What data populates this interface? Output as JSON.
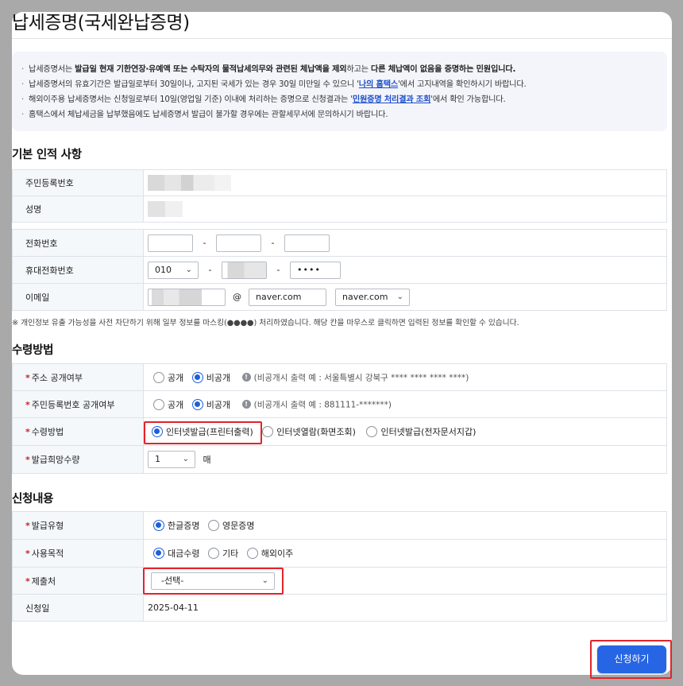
{
  "title": "납세증명(국세완납증명)",
  "notice": {
    "l1_a": "납세증명서는 ",
    "l1_b": "발급일 현재 기한연장·유예액 또는 수탁자의 물적납세의무와 관련된 체납액을 제외",
    "l1_c": "하고는 ",
    "l1_d": "다른 체납액이 없음을 증명하는 민원입니다.",
    "l2_a": "납세증명서의 유효기간은 발급일로부터 30일이나, 고지된 국세가 있는 경우 30일 미만일 수 있으니 '",
    "l2_link": "나의 홈택스",
    "l2_b": "'에서 고지내역을 확인하시기 바랍니다.",
    "l3_a": "해외이주용 납세증명서는 신청일로부터 10일(영업일 기준) 이내에 처리하는 증명으로 신청결과는 '",
    "l3_link": "민원증명 처리결과 조회",
    "l3_b": "'에서 확인 가능합니다.",
    "l4": "홈택스에서 체납세금을 납부했음에도 납세증명서 발급이 불가할 경우에는 관할세무서에 문의하시기 바랍니다."
  },
  "basic": {
    "heading": "기본 인적 사항",
    "rrn_label": "주민등록번호",
    "name_label": "성명",
    "phone_label": "전화번호",
    "mobile_label": "휴대전화번호",
    "mobile_prefix": "010",
    "mobile_last": "••••",
    "email_label": "이메일",
    "email_at": "@",
    "email_domain": "naver.com",
    "email_domain_select": "naver.com",
    "dash": "-"
  },
  "privacy_note": "※ 개인정보 유출 가능성을 사전 차단하기 위해 일부 정보를 마스킹(●●●●) 처리하였습니다. 해당 칸을 마우스로 클릭하면 입력된 정보를 확인할 수 있습니다.",
  "receive": {
    "heading": "수령방법",
    "addr_label": "주소 공개여부",
    "rrn_open_label": "주민등록번호 공개여부",
    "public": "공개",
    "private": "비공개",
    "addr_hint": "(비공개시 출력 예 : 서울특별시 강북구 **** **** **** ****)",
    "rrn_hint": "(비공개시 출력 예 : 881111-*******)",
    "method_label": "수령방법",
    "method_opt1": "인터넷발급(프린터출력)",
    "method_opt2": "인터넷열람(화면조회)",
    "method_opt3": "인터넷발급(전자문서지갑)",
    "qty_label": "발급희망수량",
    "qty_value": "1",
    "qty_unit": "매"
  },
  "apply": {
    "heading": "신청내용",
    "type_label": "발급유형",
    "type_opt1": "한글증명",
    "type_opt2": "영문증명",
    "purpose_label": "사용목적",
    "purpose_opt1": "대금수령",
    "purpose_opt2": "기타",
    "purpose_opt3": "해외이주",
    "submit_to_label": "제출처",
    "submit_to_value": "-선택-",
    "date_label": "신청일",
    "date_value": "2025-04-11"
  },
  "submit_button": "신청하기",
  "required_mark": "*",
  "colors": {
    "accent": "#2666e4",
    "highlight": "#e3232b",
    "header_bg": "#f4f8fb"
  }
}
